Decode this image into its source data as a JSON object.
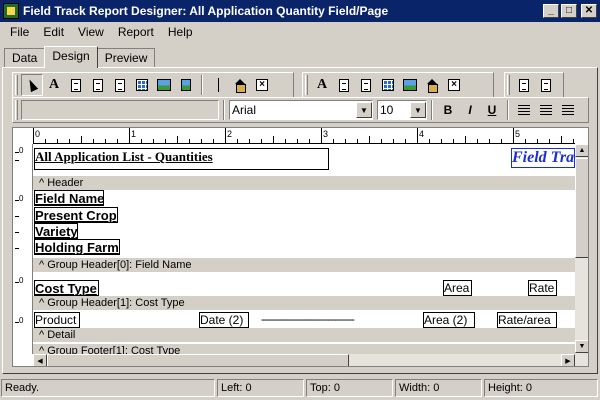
{
  "window": {
    "title": "Field Track Report Designer: All Application Quantity Field/Page"
  },
  "menu": [
    "File",
    "Edit",
    "View",
    "Report",
    "Help"
  ],
  "tabs": [
    "Data",
    "Design",
    "Preview"
  ],
  "font": {
    "name": "Arial",
    "size": "10"
  },
  "format_buttons": {
    "bold": "B",
    "italic": "I",
    "underline": "U"
  },
  "ruler": [
    "0",
    "1",
    "2",
    "3",
    "4",
    "5"
  ],
  "report": {
    "title": "All Application List - Quantities",
    "logo": "Field Tra",
    "bands": {
      "header": "^ Header",
      "group0": "^ Group Header[0]: Field Name",
      "group1": "^ Group Header[1]: Cost Type",
      "detail": "^ Detail",
      "footer1": "^ Group Footer[1]: Cost Type"
    },
    "fields": {
      "field_name": "Field Name",
      "present_crop": "Present Crop",
      "variety": "Variety",
      "holding_farm": "Holding Farm",
      "cost_type": "Cost Type",
      "area_header": "Area",
      "rate_header": "Rate",
      "product": "Product",
      "date2": "Date (2)",
      "dashes": "-------------------------------",
      "area2": "Area (2)",
      "rate_area": "Rate/area"
    }
  },
  "status": {
    "ready": "Ready.",
    "left": "Left: 0",
    "top": "Top: 0",
    "width": "Width: 0",
    "height": "Height: 0"
  }
}
